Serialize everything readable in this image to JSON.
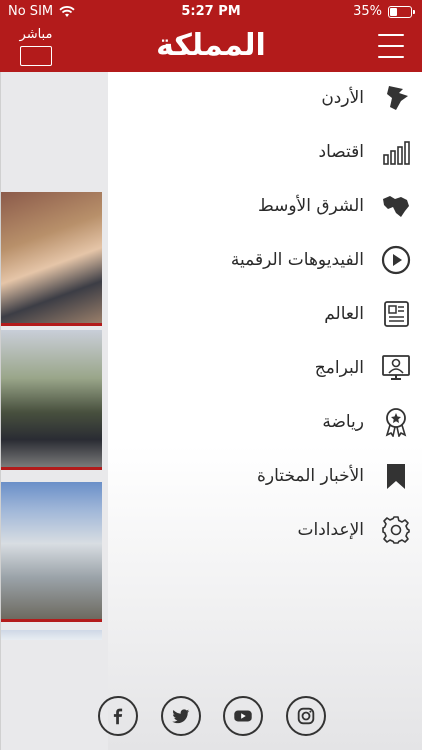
{
  "status": {
    "carrier": "No SIM",
    "time": "5:27 PM",
    "battery": "35%",
    "battery_level": 0.35
  },
  "header": {
    "live_label": "مباشر",
    "logo_text": "المملكة"
  },
  "menu": {
    "items": [
      {
        "label": "الأردن",
        "icon": "jordan-map-icon"
      },
      {
        "label": "اقتصاد",
        "icon": "bar-chart-icon"
      },
      {
        "label": "الشرق الأوسط",
        "icon": "middle-east-map-icon"
      },
      {
        "label": "الفيديوهات الرقمية",
        "icon": "play-circle-icon"
      },
      {
        "label": "العالم",
        "icon": "newspaper-icon"
      },
      {
        "label": "البرامج",
        "icon": "presenter-icon"
      },
      {
        "label": "رياضة",
        "icon": "medal-icon"
      },
      {
        "label": "الأخبار المختارة",
        "icon": "bookmark-icon"
      },
      {
        "label": "الإعدادات",
        "icon": "gear-icon"
      }
    ]
  },
  "social": [
    "facebook-icon",
    "twitter-icon",
    "youtube-icon",
    "instagram-icon"
  ]
}
